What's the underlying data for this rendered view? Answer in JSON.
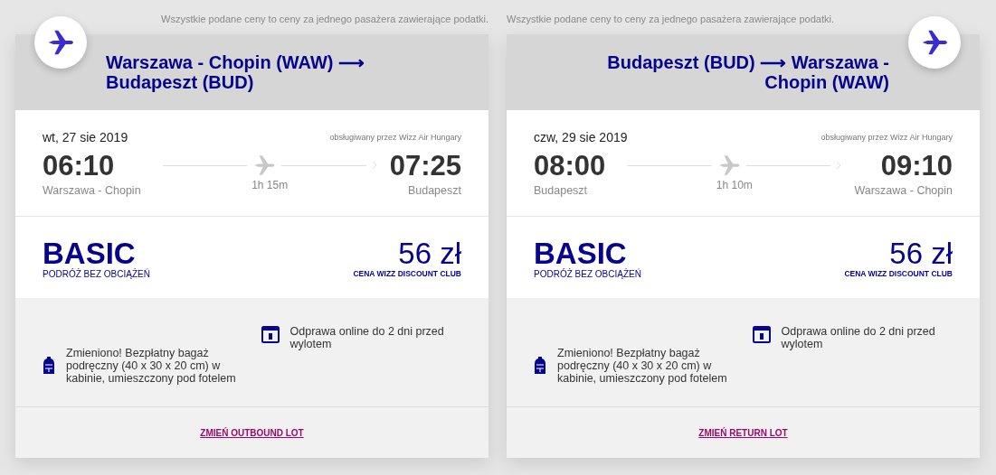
{
  "flights": [
    {
      "kind": "outbound",
      "note": "Wszystkie podane ceny to ceny za jednego pasażera zawierające podatki.",
      "route": "Warszawa - Chopin (WAW) ⟶ Budapeszt (BUD)",
      "date": "wt, 27 sie 2019",
      "operator": "obsługiwany przez Wizz Air Hungary",
      "depart_time": "06:10",
      "depart_city": "Warszawa - Chopin",
      "duration": "1h 15m",
      "arrive_time": "07:25",
      "arrive_city": "Budapeszt",
      "fare": "BASIC",
      "fare_sub": "PODRÓŻ BEZ OBCIĄŻEŃ",
      "price": "56 zł",
      "price_sub": "CENA WIZZ DISCOUNT CLUB",
      "features": [
        {
          "kind": "bag",
          "text": "Zmieniono! Bezpłatny bagaż podręczny (40 x 30 x 20 cm) w kabinie, umieszczony pod fotelem"
        },
        {
          "kind": "calendar",
          "text": "Odprawa online do 2 dni przed wylotem"
        }
      ],
      "link": "ZMIEŃ OUTBOUND LOT"
    },
    {
      "kind": "return",
      "note": "Wszystkie podane ceny to ceny za jednego pasażera zawierające podatki.",
      "route": "Budapeszt (BUD) ⟶ Warszawa - Chopin (WAW)",
      "date": "czw, 29 sie 2019",
      "operator": "obsługiwany przez Wizz Air Hungary",
      "depart_time": "08:00",
      "depart_city": "Budapeszt",
      "duration": "1h 10m",
      "arrive_time": "09:10",
      "arrive_city": "Warszawa - Chopin",
      "fare": "BASIC",
      "fare_sub": "PODRÓŻ BEZ OBCIĄŻEŃ",
      "price": "56 zł",
      "price_sub": "CENA WIZZ DISCOUNT CLUB",
      "features": [
        {
          "kind": "bag",
          "text": "Zmieniono! Bezpłatny bagaż podręczny (40 x 30 x 20 cm) w kabinie, umieszczony pod fotelem"
        },
        {
          "kind": "calendar",
          "text": "Odprawa online do 2 dni przed wylotem"
        }
      ],
      "link": "ZMIEŃ RETURN LOT"
    }
  ]
}
